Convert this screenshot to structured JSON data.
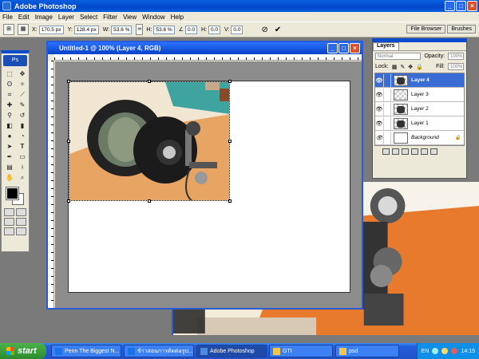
{
  "app": {
    "title": "Adobe Photoshop"
  },
  "menu": [
    "File",
    "Edit",
    "Image",
    "Layer",
    "Select",
    "Filter",
    "View",
    "Window",
    "Help"
  ],
  "options": {
    "x_label": "X:",
    "x_value": "170.5 px",
    "y_label": "Y:",
    "y_value": "128.4 px",
    "w_label": "W:",
    "w_value": "53.6 %",
    "h_label": "H:",
    "h_value": "53.6 %",
    "angle_value": "0.0",
    "hskew_label": "H:",
    "hskew_value": "0.0",
    "vskew_label": "V:",
    "vskew_value": "0.0"
  },
  "palette_well": {
    "file_browser": "File Browser",
    "brushes": "Brushes"
  },
  "document": {
    "title": "Untitled-1 @ 100% (Layer 4, RGB)"
  },
  "layers_palette": {
    "tab": "Layers",
    "blend_mode": "Normal",
    "opacity_label": "Opacity:",
    "opacity_value": "100%",
    "lock_label": "Lock:",
    "fill_label": "Fill:",
    "fill_value": "100%",
    "layers": [
      "Layer 4",
      "Layer 3",
      "Layer 2",
      "Layer 1",
      "Background"
    ]
  },
  "taskbar": {
    "start": "start",
    "items": [
      "Penn The Biggest N...",
      "ข้าวสอนการตัดต่อรูป...",
      "Adobe Photoshop",
      "GTI",
      "psd"
    ],
    "lang": "EN",
    "clock": "14:15"
  }
}
